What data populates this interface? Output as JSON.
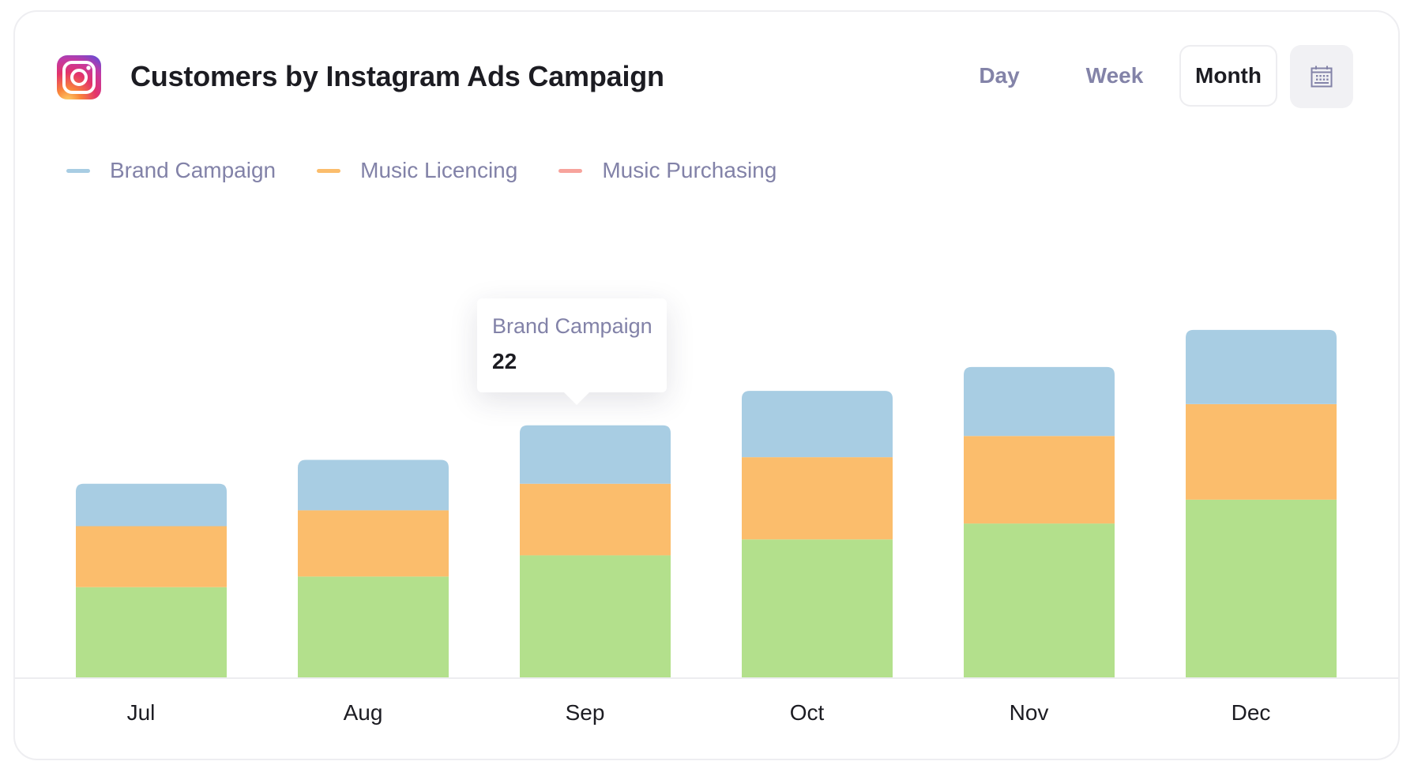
{
  "header": {
    "icon": "instagram-icon",
    "title": "Customers by Instagram Ads Campaign"
  },
  "period_selector": {
    "options": [
      {
        "label": "Day",
        "selected": false
      },
      {
        "label": "Week",
        "selected": false
      },
      {
        "label": "Month",
        "selected": true
      }
    ],
    "calendar_icon": "calendar-icon"
  },
  "legend": [
    {
      "label": "Brand Campaign",
      "color": "#a8cde3"
    },
    {
      "label": "Music Licencing",
      "color": "#fbbd6c"
    },
    {
      "label": "Music Purchasing",
      "color": "#f7a39c"
    }
  ],
  "tooltip": {
    "series": "Brand Campaign",
    "category": "Sep",
    "value": "22"
  },
  "chart_data": {
    "type": "bar",
    "stacked": true,
    "title": "Customers by Instagram Ads Campaign",
    "xlabel": "",
    "ylabel": "",
    "categories": [
      "Jul",
      "Aug",
      "Sep",
      "Oct",
      "Nov",
      "Dec"
    ],
    "series": [
      {
        "name": "Music Purchasing",
        "color": "#b3e08c",
        "values": [
          34,
          38,
          46,
          52,
          58,
          67
        ]
      },
      {
        "name": "Music Licencing",
        "color": "#fbbd6c",
        "values": [
          23,
          25,
          27,
          31,
          33,
          36
        ]
      },
      {
        "name": "Brand Campaign",
        "color": "#a8cde3",
        "values": [
          16,
          19,
          22,
          25,
          26,
          28
        ]
      }
    ],
    "ylim": [
      0,
      140
    ],
    "grid": false,
    "y_axis_visible": false,
    "legend_position": "top-left"
  }
}
